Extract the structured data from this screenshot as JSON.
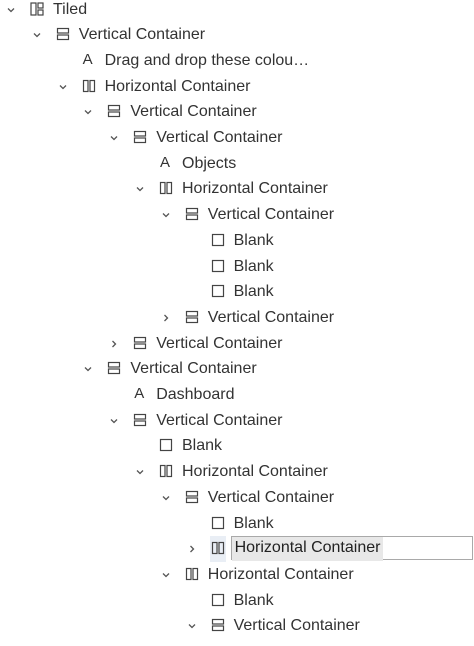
{
  "tree": {
    "rows": [
      {
        "label": "Tiled",
        "icon": "tiled-icon",
        "depth": 0,
        "chevron": "down"
      },
      {
        "label": "Vertical Container",
        "icon": "vertical-container-icon",
        "depth": 1,
        "chevron": "down"
      },
      {
        "label": "Drag and drop these colou…",
        "icon": "text-icon",
        "depth": 2,
        "chevron": "none"
      },
      {
        "label": "Horizontal Container",
        "icon": "horizontal-container-icon",
        "depth": 2,
        "chevron": "down"
      },
      {
        "label": "Vertical Container",
        "icon": "vertical-container-icon",
        "depth": 3,
        "chevron": "down"
      },
      {
        "label": "Vertical Container",
        "icon": "vertical-container-icon",
        "depth": 4,
        "chevron": "down"
      },
      {
        "label": "Objects",
        "icon": "text-icon",
        "depth": 5,
        "chevron": "none"
      },
      {
        "label": "Horizontal Container",
        "icon": "horizontal-container-icon",
        "depth": 5,
        "chevron": "down"
      },
      {
        "label": "Vertical Container",
        "icon": "vertical-container-icon",
        "depth": 6,
        "chevron": "down"
      },
      {
        "label": "Blank",
        "icon": "blank-icon",
        "depth": 7,
        "chevron": "none"
      },
      {
        "label": "Blank",
        "icon": "blank-icon",
        "depth": 7,
        "chevron": "none"
      },
      {
        "label": "Blank",
        "icon": "blank-icon",
        "depth": 7,
        "chevron": "none"
      },
      {
        "label": "Vertical Container",
        "icon": "vertical-container-icon",
        "depth": 6,
        "chevron": "right"
      },
      {
        "label": "Vertical Container",
        "icon": "vertical-container-icon",
        "depth": 4,
        "chevron": "right"
      },
      {
        "label": "Vertical Container",
        "icon": "vertical-container-icon",
        "depth": 3,
        "chevron": "down"
      },
      {
        "label": "Dashboard",
        "icon": "text-icon",
        "depth": 4,
        "chevron": "none"
      },
      {
        "label": "Vertical Container",
        "icon": "vertical-container-icon",
        "depth": 4,
        "chevron": "down"
      },
      {
        "label": "Blank",
        "icon": "blank-icon",
        "depth": 5,
        "chevron": "none"
      },
      {
        "label": "Horizontal Container",
        "icon": "horizontal-container-icon",
        "depth": 5,
        "chevron": "down"
      },
      {
        "label": "Vertical Container",
        "icon": "vertical-container-icon",
        "depth": 6,
        "chevron": "down"
      },
      {
        "label": "Blank",
        "icon": "blank-icon",
        "depth": 7,
        "chevron": "none"
      },
      {
        "label": "Horizontal Container",
        "icon": "horizontal-container-icon",
        "depth": 7,
        "chevron": "right",
        "editing": true
      },
      {
        "label": "Horizontal Container",
        "icon": "horizontal-container-icon",
        "depth": 6,
        "chevron": "down"
      },
      {
        "label": "Blank",
        "icon": "blank-icon",
        "depth": 7,
        "chevron": "none"
      },
      {
        "label": "Vertical Container",
        "icon": "vertical-container-icon",
        "depth": 7,
        "chevron": "down"
      }
    ]
  }
}
